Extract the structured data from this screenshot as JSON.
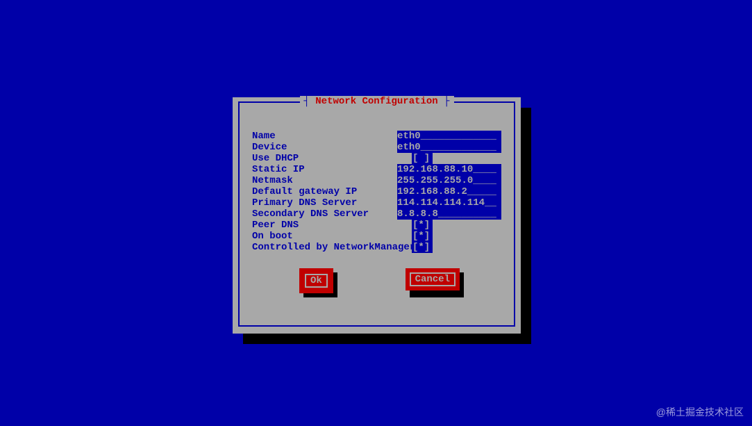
{
  "dialog": {
    "title": "Network Configuration",
    "fields": [
      {
        "label": "Name",
        "type": "text",
        "value": "eth0"
      },
      {
        "label": "Device",
        "type": "text",
        "value": "eth0"
      },
      {
        "label": "Use DHCP",
        "type": "check",
        "value": "[ ]"
      },
      {
        "label": "Static IP",
        "type": "text",
        "value": "192.168.88.10"
      },
      {
        "label": "Netmask",
        "type": "text",
        "value": "255.255.255.0"
      },
      {
        "label": "Default gateway IP",
        "type": "text",
        "value": "192.168.88.2"
      },
      {
        "label": "Primary DNS Server",
        "type": "text",
        "value": "114.114.114.114"
      },
      {
        "label": "Secondary DNS Server",
        "type": "text",
        "value": "8.8.8.8"
      },
      {
        "label": "Peer DNS",
        "type": "check",
        "value": "[*]"
      },
      {
        "label": "On boot",
        "type": "check",
        "value": "[*]"
      },
      {
        "label": "Controlled by NetworkManager",
        "type": "check",
        "value": "[*]"
      }
    ],
    "buttons": {
      "ok": "Ok",
      "cancel": "Cancel"
    }
  },
  "watermark": "@稀土掘金技术社区"
}
